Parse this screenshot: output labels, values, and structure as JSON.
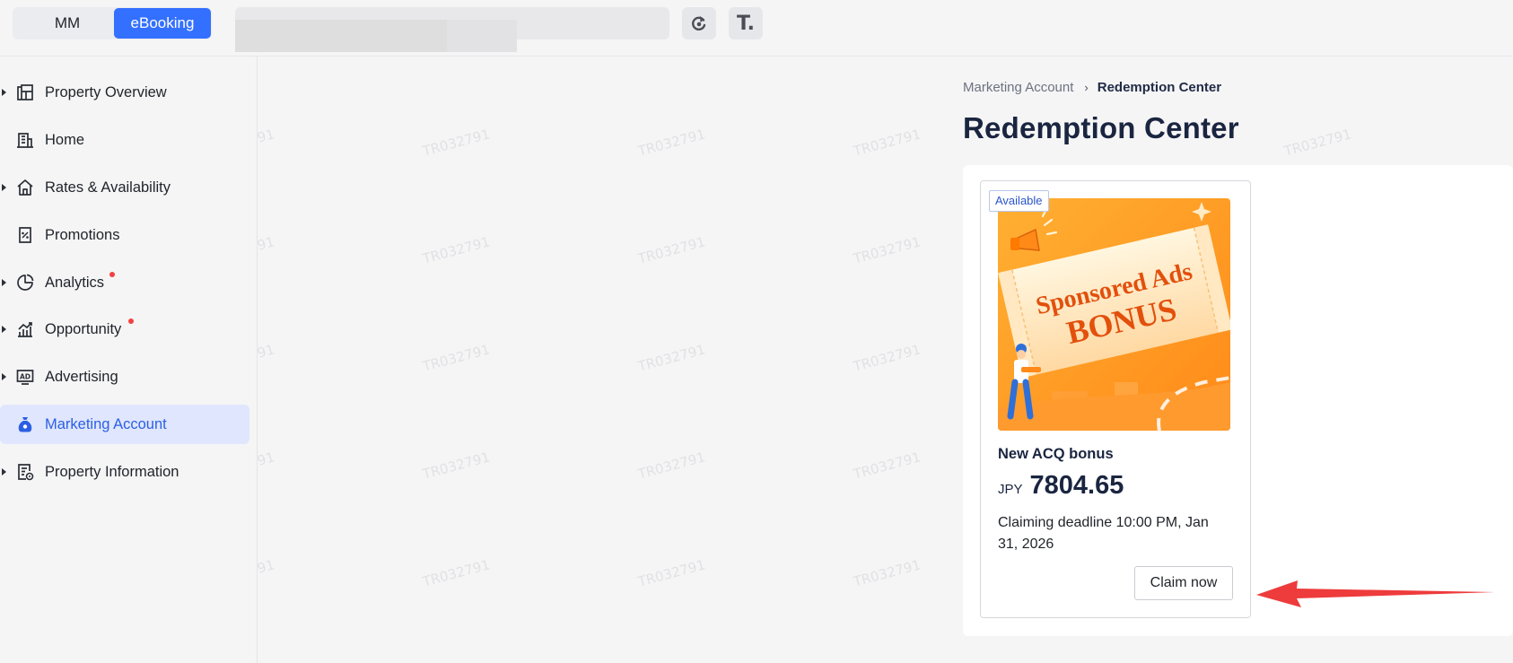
{
  "topbar": {
    "switch_mm": "MM",
    "switch_ebooking": "eBooking",
    "icons": [
      "refresh-icon",
      "text-t-icon"
    ],
    "text_button": "T."
  },
  "sidebar": {
    "items": [
      {
        "label": "Property Overview",
        "icon": "overview-icon",
        "expandable": true,
        "dot": false
      },
      {
        "label": "Home",
        "icon": "building-icon",
        "expandable": false,
        "dot": false
      },
      {
        "label": "Rates & Availability",
        "icon": "house-icon",
        "expandable": true,
        "dot": false
      },
      {
        "label": "Promotions",
        "icon": "discount-icon",
        "expandable": false,
        "dot": false
      },
      {
        "label": "Analytics",
        "icon": "pie-chart-icon",
        "expandable": true,
        "dot": true
      },
      {
        "label": "Opportunity",
        "icon": "growth-chart-icon",
        "expandable": true,
        "dot": true
      },
      {
        "label": "Advertising",
        "icon": "ad-icon",
        "expandable": true,
        "dot": false
      },
      {
        "label": "Marketing Account",
        "icon": "money-bag-icon",
        "expandable": false,
        "dot": false,
        "active": true
      },
      {
        "label": "Property Information",
        "icon": "property-info-icon",
        "expandable": true,
        "dot": false
      }
    ]
  },
  "breadcrumb": {
    "parent": "Marketing Account",
    "separator": "›",
    "current": "Redemption Center"
  },
  "page": {
    "title": "Redemption Center"
  },
  "card": {
    "badge": "Available",
    "image_text_line1": "Sponsored Ads",
    "image_text_line2": "BONUS",
    "title": "New ACQ bonus",
    "currency": "JPY",
    "amount": "7804.65",
    "deadline": "Claiming deadline 10:00 PM, Jan 31, 2026",
    "claim_button": "Claim now"
  },
  "watermark": "TR032791",
  "colors": {
    "accent": "#3370ff",
    "active_bg": "#dfe6fd",
    "dot": "#f53f3f",
    "arrow": "#ee3b3b",
    "title": "#1a2540"
  }
}
